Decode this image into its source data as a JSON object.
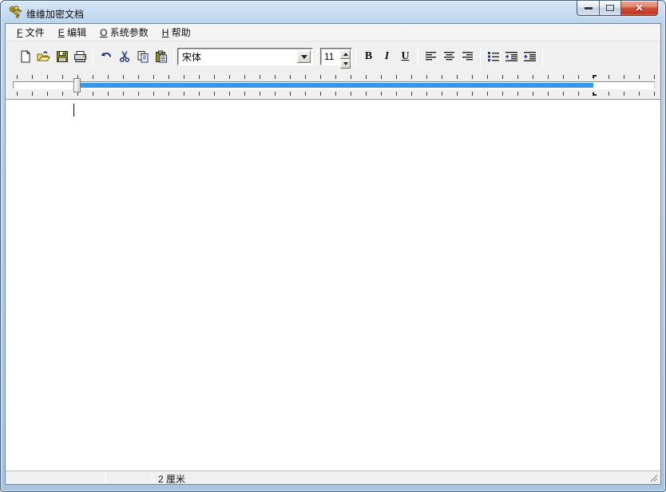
{
  "window": {
    "title": "维维加密文档"
  },
  "menu": {
    "items": [
      {
        "hotkey": "F",
        "label": "文件"
      },
      {
        "hotkey": "E",
        "label": "编辑"
      },
      {
        "hotkey": "O",
        "label": "系统参数"
      },
      {
        "hotkey": "H",
        "label": "帮助"
      }
    ]
  },
  "toolbar": {
    "font_name": "宋体",
    "font_size": "11",
    "bold": "B",
    "italic": "I",
    "underline": "U",
    "icon_names": [
      "new-document-icon",
      "open-folder-icon",
      "save-icon",
      "print-icon",
      "undo-icon",
      "cut-icon",
      "copy-icon",
      "paste-icon",
      "align-left-icon",
      "align-center-icon",
      "align-right-icon",
      "bullet-list-icon",
      "indent-icon",
      "outdent-icon"
    ]
  },
  "status": {
    "position": "2 厘米"
  },
  "colors": {
    "ruler_active_bar": "#3398ed",
    "close_button_red": "#c13a24",
    "frame_blue": "#b2cbe6"
  }
}
